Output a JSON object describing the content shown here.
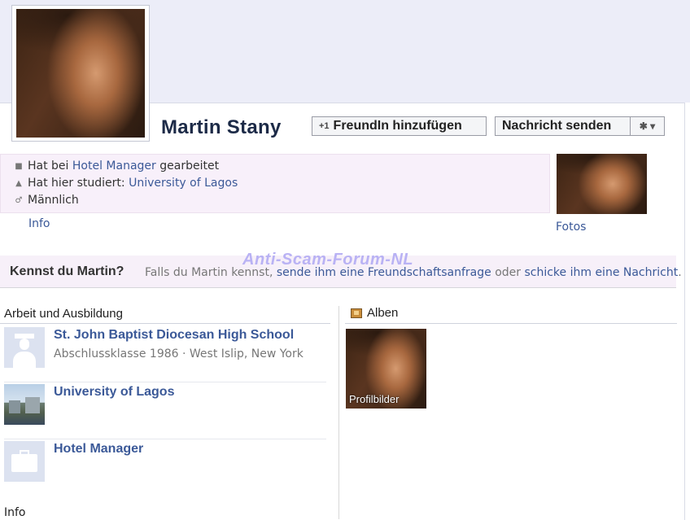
{
  "profile": {
    "name": "Martin Stany"
  },
  "buttons": {
    "add_friend": "FreundIn hinzufügen",
    "send_message": "Nachricht senden"
  },
  "info": {
    "work_prefix": "Hat bei",
    "work_link": "Hotel Manager",
    "work_suffix": "gearbeitet",
    "study_prefix": "Hat hier studiert:",
    "study_link": "University of Lagos",
    "gender": "Männlich",
    "info_link": "Info",
    "fotos_link": "Fotos"
  },
  "watermark": "Anti-Scam-Forum-NL",
  "kennst": {
    "title": "Kennst du Martin?",
    "text_1": "Falls du Martin kennst,",
    "link_1": "sende ihm eine Freundschaftsanfrage",
    "text_2": "oder",
    "link_2": "schicke ihm eine Nachricht",
    "text_3": "."
  },
  "arbeit": {
    "heading": "Arbeit und Ausbildung",
    "entries": [
      {
        "title": "St. John Baptist Diocesan High School",
        "subtitle": "Abschlussklasse 1986 · West Islip, New York",
        "icon": "graduate-icon"
      },
      {
        "title": "University of Lagos",
        "subtitle": "",
        "icon": "campus-photo"
      },
      {
        "title": "Hotel Manager",
        "subtitle": "",
        "icon": "briefcase-icon"
      }
    ]
  },
  "alben": {
    "heading": "Alben",
    "albums": [
      {
        "label": "Profilbilder"
      }
    ]
  },
  "bottom": {
    "info_heading": "Info"
  }
}
